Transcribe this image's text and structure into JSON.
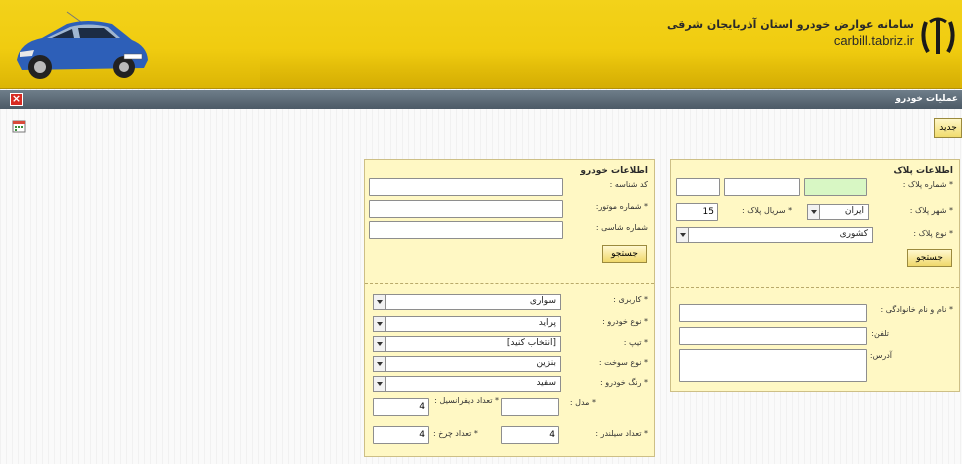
{
  "header": {
    "title": "سامانه عوارض خودرو استان آذربایجان شرقی",
    "url": "carbill.tabriz.ir"
  },
  "titlebar": {
    "title": "عملیات خودرو",
    "close": "×"
  },
  "toolbar": {
    "new_label": "جدید"
  },
  "plate_panel": {
    "title": "اطلاعات پلاک",
    "plate_number_label": "* شماره پلاک :",
    "plate_city_label": "* شهر پلاک :",
    "plate_city_value": "ایران",
    "plate_serial_label": "* سریال پلاک :",
    "plate_serial_value": "15",
    "plate_type_label": "* نوع پلاک :",
    "plate_type_value": "کشوری",
    "search_label": "جستجو",
    "fullname_label": "* نام و نام خانوادگی :",
    "phone_label": "تلفن:",
    "address_label": "آدرس:"
  },
  "car_panel": {
    "title": "اطلاعات خودرو",
    "id_label": "کد شناسه :",
    "engine_label": "* شماره موتور:",
    "chassis_label": "شماره شاسی :",
    "search_label": "جستجو",
    "usage_label": "* کاربری :",
    "usage_value": "سواری",
    "type_label": "* نوع خودرو :",
    "type_value": "پراید",
    "tip_label": "* تیپ :",
    "tip_value": "[انتخاب کنید]",
    "fuel_label": "* نوع سوخت :",
    "fuel_value": "بنزین",
    "color_label": "* رنگ خودرو :",
    "color_value": "سفید",
    "model_label": "* مدل :",
    "diff_label": "* تعداد دیفرانسیل :",
    "diff_value": "4",
    "cyl_label": "* تعداد سیلندر :",
    "cyl_value": "4",
    "wheel_label": "* تعداد چرخ :",
    "wheel_value": "4"
  },
  "colors": {
    "banner": "#f0cc10",
    "panel": "#fff8c4",
    "titlebar": "#4c5a66"
  },
  "icons": {
    "calendar": "calendar-icon",
    "logo": "emblem-logo",
    "car": "car-image"
  }
}
